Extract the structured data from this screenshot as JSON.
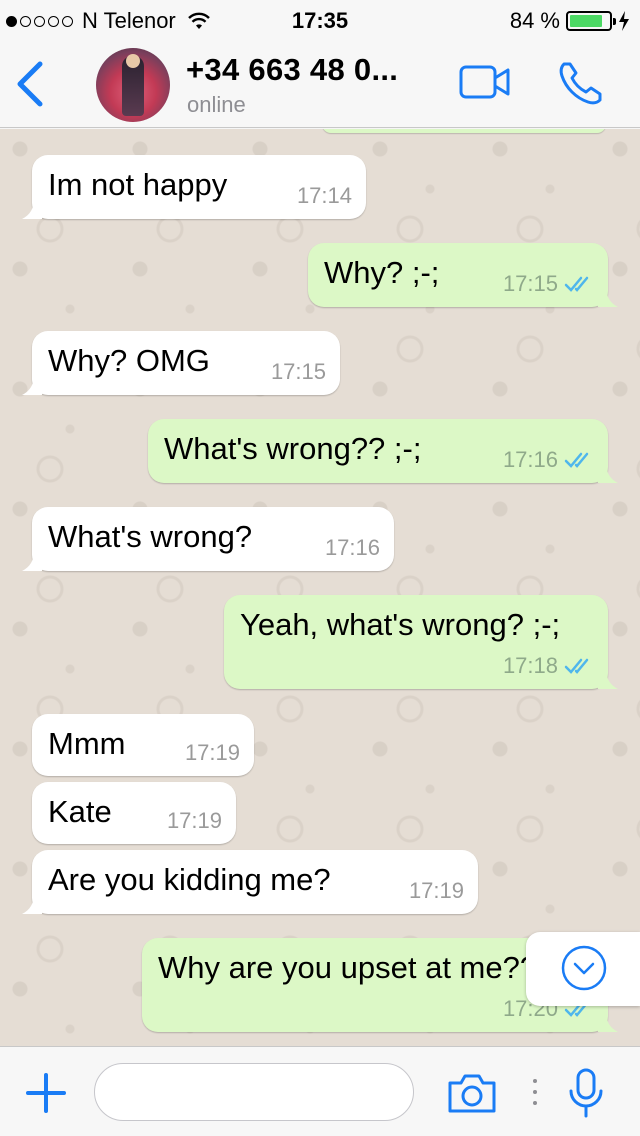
{
  "status_bar": {
    "signal_dots": [
      true,
      false,
      false,
      false,
      false
    ],
    "carrier": "N Telenor",
    "time": "17:35",
    "battery_percent": "84 %",
    "battery_level": 0.84
  },
  "header": {
    "back_icon": "chevron-left-icon",
    "contact_name": "+34 663 48 0...",
    "contact_status": "online",
    "video_icon": "video-camera-icon",
    "call_icon": "phone-icon",
    "accent_color": "#1a7cf5"
  },
  "messages": [
    {
      "id": "m1",
      "direction": "in",
      "text": "Im not happy",
      "time": "17:14"
    },
    {
      "id": "m2",
      "direction": "out",
      "text": "Why? ;-;",
      "time": "17:15",
      "read": true
    },
    {
      "id": "m3",
      "direction": "in",
      "text": "Why? OMG",
      "time": "17:15"
    },
    {
      "id": "m4",
      "direction": "out",
      "text": "What's wrong?? ;-;",
      "time": "17:16",
      "read": true
    },
    {
      "id": "m5",
      "direction": "in",
      "text": "What's wrong?",
      "time": "17:16"
    },
    {
      "id": "m6",
      "direction": "out",
      "text": "Yeah, what's wrong? ;-;",
      "time": "17:18",
      "read": true
    },
    {
      "id": "m7",
      "direction": "in",
      "text": "Mmm",
      "time": "17:19"
    },
    {
      "id": "m8",
      "direction": "in",
      "text": "Kate",
      "time": "17:19"
    },
    {
      "id": "m9",
      "direction": "in",
      "text": "Are you kidding me?",
      "time": "17:19"
    },
    {
      "id": "m10",
      "direction": "out",
      "text": "Why are you upset at me??",
      "time": "17:20",
      "read": true
    }
  ],
  "colors": {
    "incoming_bubble": "#ffffff",
    "outgoing_bubble": "#dcf8c6",
    "chat_background": "#e5ddd4",
    "read_ticks": "#4fb6ec"
  },
  "input_bar": {
    "attach_icon": "plus-icon",
    "message_placeholder": "",
    "camera_icon": "camera-icon",
    "mic_icon": "microphone-icon"
  },
  "scroll_down_icon": "chevron-down-circle-icon"
}
